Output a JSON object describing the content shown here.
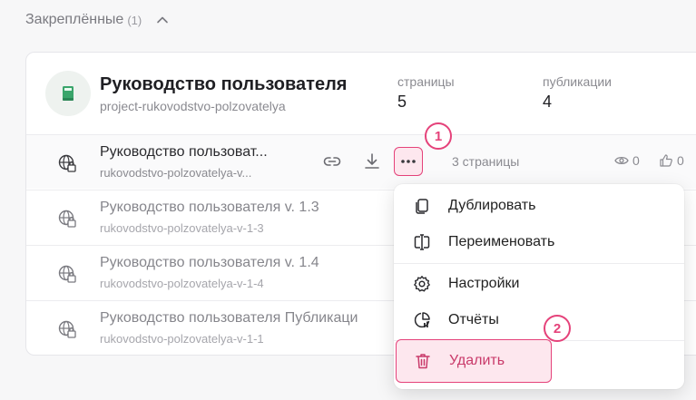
{
  "section": {
    "title": "Закреплённые",
    "count": "(1)"
  },
  "project": {
    "title": "Руководство пользователя",
    "slug": "project-rukovodstvo-polzovatelya",
    "stats": [
      {
        "label": "страницы",
        "value": "5"
      },
      {
        "label": "публикации",
        "value": "4"
      }
    ]
  },
  "rows": [
    {
      "title": "Руководство пользоват...",
      "slug": "rukovodstvo-polzovatelya-v...",
      "pages": "3 страницы",
      "views": "0",
      "likes": "0"
    },
    {
      "title": "Руководство пользователя v. 1.3",
      "slug": "rukovodstvo-polzovatelya-v-1-3"
    },
    {
      "title": "Руководство пользователя v. 1.4",
      "slug": "rukovodstvo-polzovatelya-v-1-4"
    },
    {
      "title": "Руководство пользователя Публикаци",
      "slug": "rukovodstvo-polzovatelya-v-1-1"
    }
  ],
  "menu": {
    "items": [
      {
        "label": "Дублировать",
        "icon": "copy-icon"
      },
      {
        "label": "Переименовать",
        "icon": "rename-icon"
      },
      {
        "label": "Настройки",
        "icon": "gear-icon"
      },
      {
        "label": "Отчёты",
        "icon": "report-icon"
      },
      {
        "label": "Удалить",
        "icon": "trash-icon"
      }
    ]
  },
  "steps": [
    "1",
    "2"
  ],
  "colors": {
    "accent": "#e5427a",
    "accent_bg": "#fde7ee",
    "card_bg": "#ffffff",
    "page_bg": "#f7f7f8"
  }
}
